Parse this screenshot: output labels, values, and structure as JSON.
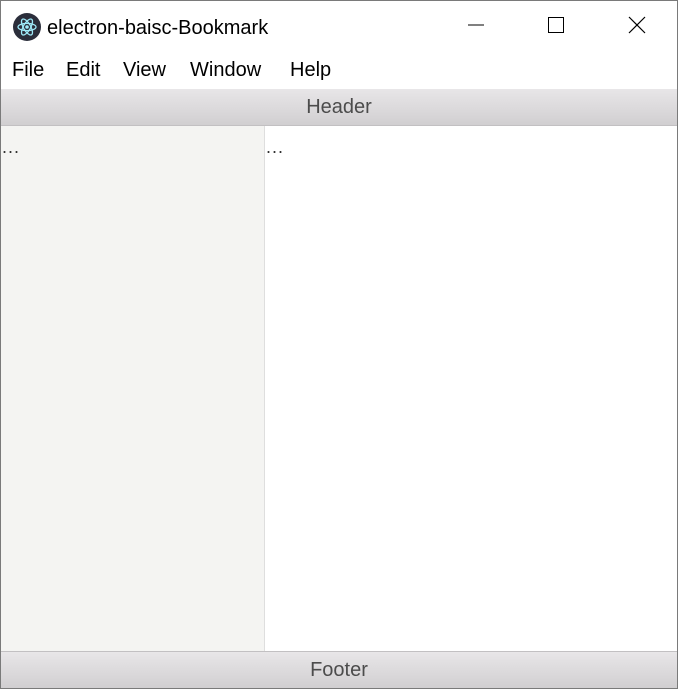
{
  "window": {
    "title": "electron-baisc-Bookmark",
    "icon": "electron-atom-icon",
    "controls": {
      "minimize_icon": "minimize-icon",
      "maximize_icon": "maximize-icon",
      "close_icon": "close-icon"
    }
  },
  "menu": {
    "items": [
      {
        "label": "File"
      },
      {
        "label": "Edit"
      },
      {
        "label": "View"
      },
      {
        "label": "Window"
      },
      {
        "label": "Help"
      }
    ]
  },
  "header": {
    "text": "Header"
  },
  "sidebar": {
    "text": "..."
  },
  "main": {
    "text": "..."
  },
  "footer": {
    "text": "Footer"
  },
  "colors": {
    "bar_gradient_top": "#e8e6e8",
    "bar_gradient_bottom": "#d1cfd1",
    "bar_text": "#4c4c4c",
    "sidebar_bg": "#f4f4f2",
    "main_bg": "#ffffff"
  }
}
